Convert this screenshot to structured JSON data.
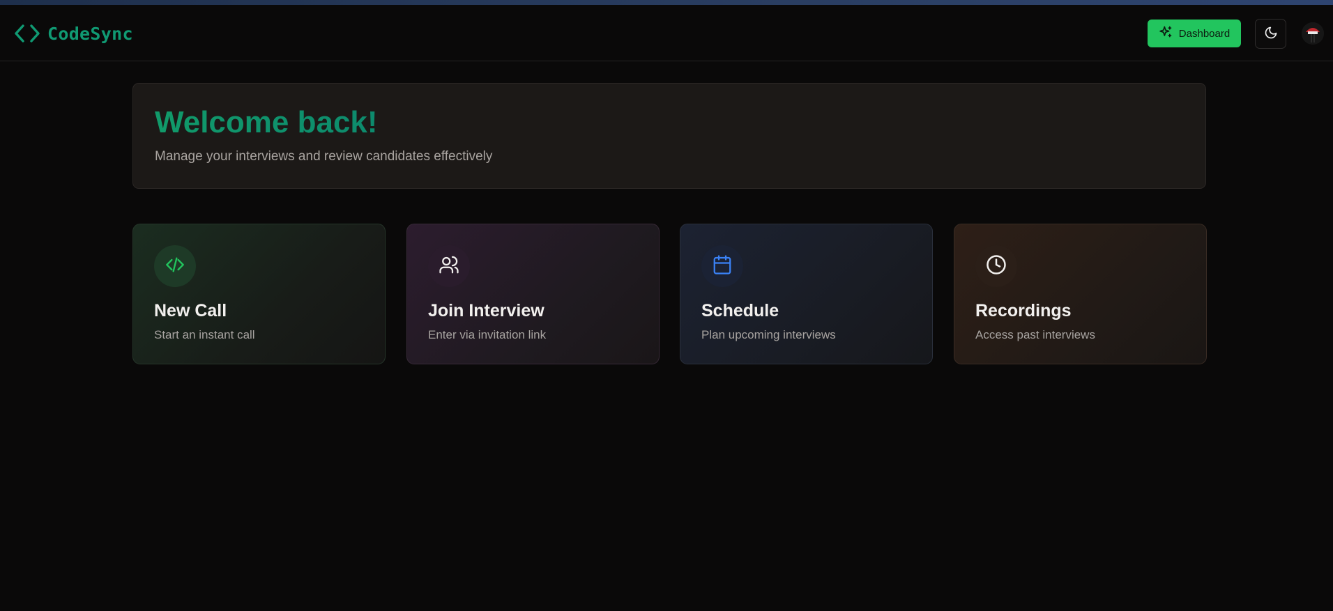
{
  "header": {
    "brand_name": "CodeSync",
    "dashboard_label": "Dashboard",
    "icons": {
      "brand": "code-brackets-icon",
      "dashboard": "sparkles-icon",
      "theme": "moon-icon"
    }
  },
  "welcome": {
    "title": "Welcome back!",
    "subtitle": "Manage your interviews and review candidates effectively"
  },
  "actions": [
    {
      "title": "New Call",
      "subtitle": "Start an instant call",
      "icon": "code-icon",
      "accent": "#22c55e"
    },
    {
      "title": "Join Interview",
      "subtitle": "Enter via invitation link",
      "icon": "users-icon",
      "accent": "#f2f0ee"
    },
    {
      "title": "Schedule",
      "subtitle": "Plan upcoming interviews",
      "icon": "calendar-icon",
      "accent": "#3b82f6"
    },
    {
      "title": "Recordings",
      "subtitle": "Access past interviews",
      "icon": "clock-icon",
      "accent": "#f2f0ee"
    }
  ],
  "colors": {
    "brand": "#109a73",
    "primary_button": "#22c55e",
    "background": "#0a0909"
  }
}
